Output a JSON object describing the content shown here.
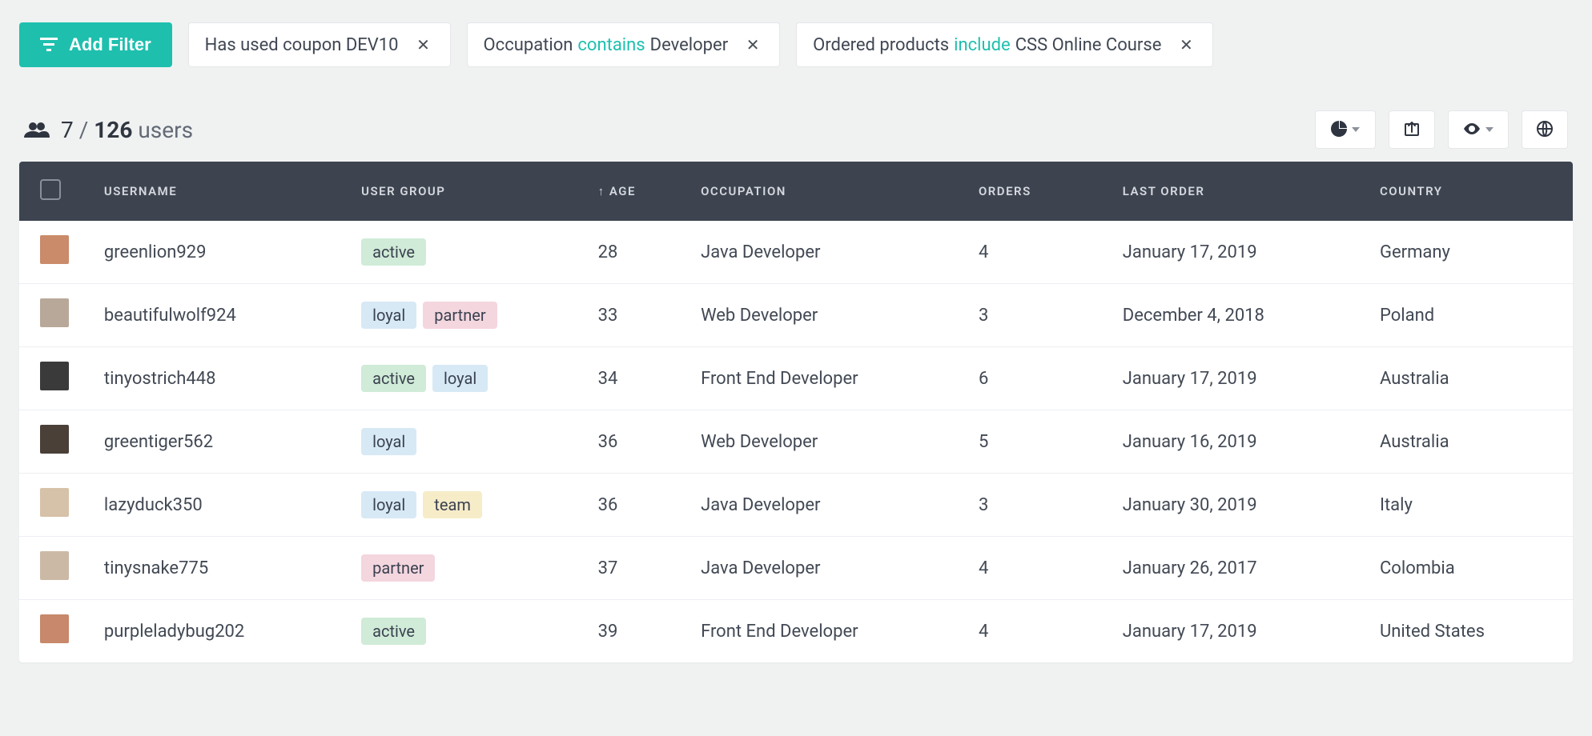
{
  "filterBar": {
    "addLabel": "Add Filter",
    "chips": [
      {
        "prefix": "Has used coupon DEV10",
        "op": "",
        "suffix": ""
      },
      {
        "prefix": "Occupation",
        "op": "contains",
        "suffix": "Developer"
      },
      {
        "prefix": "Ordered products",
        "op": "include",
        "suffix": "CSS Online Course"
      }
    ]
  },
  "results": {
    "filtered": "7",
    "separator": "/",
    "total": "126",
    "label": "users"
  },
  "columns": {
    "username": "USERNAME",
    "group": "USER GROUP",
    "age": "AGE",
    "occupation": "OCCUPATION",
    "orders": "ORDERS",
    "last": "LAST ORDER",
    "country": "COUNTRY"
  },
  "tagColors": {
    "active": "active",
    "loyal": "loyal",
    "partner": "partner",
    "team": "team"
  },
  "rows": [
    {
      "avatar": "#c98b6a",
      "username": "greenlion929",
      "tags": [
        "active"
      ],
      "age": "28",
      "occupation": "Java Developer",
      "orders": "4",
      "last": "January 17, 2019",
      "country": "Germany"
    },
    {
      "avatar": "#b8a899",
      "username": "beautifulwolf924",
      "tags": [
        "loyal",
        "partner"
      ],
      "age": "33",
      "occupation": "Web Developer",
      "orders": "3",
      "last": "December 4, 2018",
      "country": "Poland"
    },
    {
      "avatar": "#3a3a3a",
      "username": "tinyostrich448",
      "tags": [
        "active",
        "loyal"
      ],
      "age": "34",
      "occupation": "Front End Developer",
      "orders": "6",
      "last": "January 17, 2019",
      "country": "Australia"
    },
    {
      "avatar": "#4a4038",
      "username": "greentiger562",
      "tags": [
        "loyal"
      ],
      "age": "36",
      "occupation": "Web Developer",
      "orders": "5",
      "last": "January 16, 2019",
      "country": "Australia"
    },
    {
      "avatar": "#d6c2a8",
      "username": "lazyduck350",
      "tags": [
        "loyal",
        "team"
      ],
      "age": "36",
      "occupation": "Java Developer",
      "orders": "3",
      "last": "January 30, 2019",
      "country": "Italy"
    },
    {
      "avatar": "#cbb9a6",
      "username": "tinysnake775",
      "tags": [
        "partner"
      ],
      "age": "37",
      "occupation": "Java Developer",
      "orders": "4",
      "last": "January 26, 2017",
      "country": "Colombia"
    },
    {
      "avatar": "#c7886b",
      "username": "purpleladybug202",
      "tags": [
        "active"
      ],
      "age": "39",
      "occupation": "Front End Developer",
      "orders": "4",
      "last": "January 17, 2019",
      "country": "United States"
    }
  ]
}
